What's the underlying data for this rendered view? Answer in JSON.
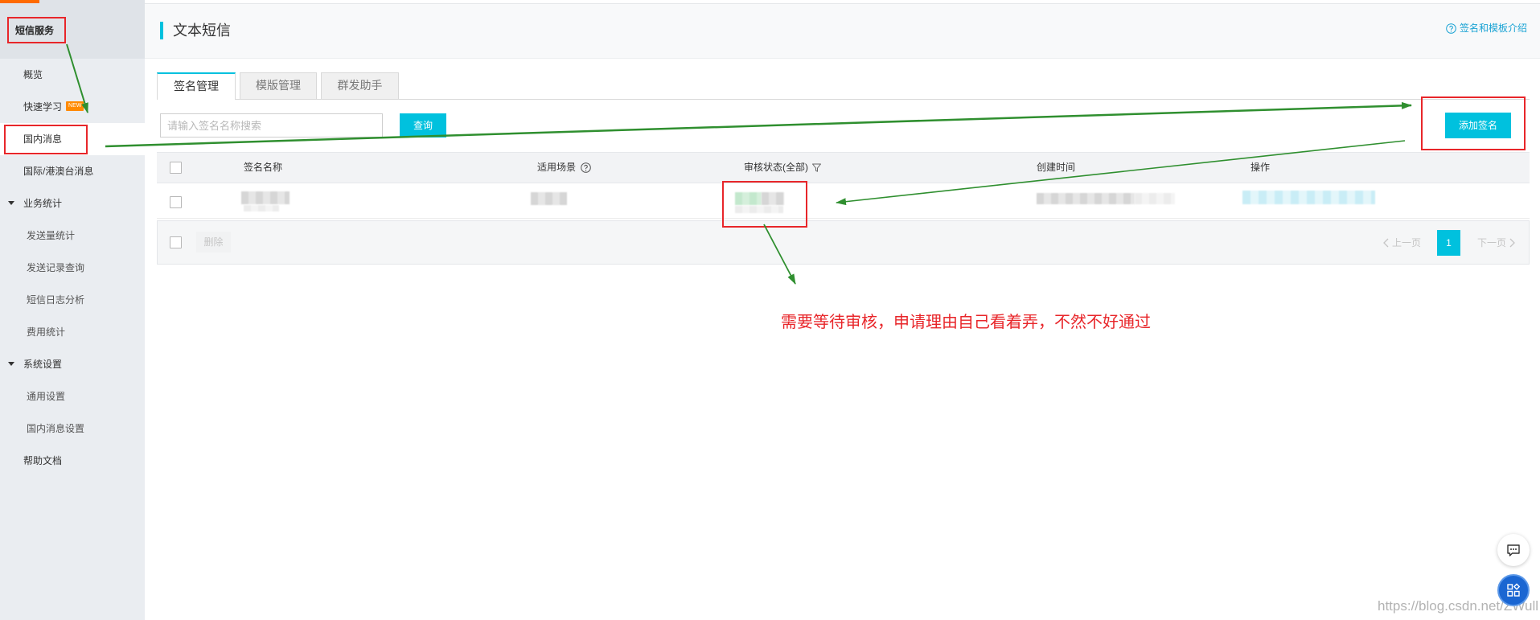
{
  "colors": {
    "accent": "#00c1de",
    "top_bar": "#ff6a00",
    "badge": "#ff8a00",
    "link": "#1aa3d4",
    "annotation_red": "#e8262a",
    "annotation_green": "#2f8f2f",
    "float_button_blue": "#1a66d2"
  },
  "sidebar": {
    "title": "短信服务",
    "items": [
      {
        "label": "概览"
      },
      {
        "label": "快速学习",
        "badge": "NEW"
      },
      {
        "label": "国内消息",
        "selected": true
      },
      {
        "label": "国际/港澳台消息"
      }
    ],
    "groups": [
      {
        "label": "业务统计",
        "expanded": true,
        "icon": "caret-down-icon",
        "children": [
          "发送量统计",
          "发送记录查询",
          "短信日志分析",
          "费用统计"
        ]
      },
      {
        "label": "系统设置",
        "expanded": true,
        "icon": "caret-down-icon",
        "children": [
          "通用设置",
          "国内消息设置"
        ]
      }
    ],
    "help_item": "帮助文档"
  },
  "header": {
    "title": "文本短信",
    "help_link": "签名和模板介绍",
    "help_icon": "question-circle-icon"
  },
  "tabs": [
    {
      "label": "签名管理",
      "active": true
    },
    {
      "label": "模版管理"
    },
    {
      "label": "群发助手"
    }
  ],
  "toolbar": {
    "search_value": "",
    "search_placeholder": "请输入签名名称搜索",
    "search_button": "查询",
    "add_button": "添加签名"
  },
  "table": {
    "columns": [
      {
        "label": "签名名称"
      },
      {
        "label": "适用场景",
        "icon": "help-icon"
      },
      {
        "label": "审核状态(全部)",
        "icon": "filter-icon"
      },
      {
        "label": "创建时间"
      },
      {
        "label": "操作"
      }
    ]
  },
  "table_footer": {
    "delete_button": "删除",
    "prev_page": "上一页",
    "current_page": "1",
    "next_page": "下一页",
    "prev_icon": "chevron-left-icon",
    "next_icon": "chevron-right-icon"
  },
  "annotation": {
    "note": "需要等待审核，申请理由自己看着弄，不然不好通过"
  },
  "floating_buttons": {
    "chat_icon": "chat-bubble-icon",
    "apps_icon": "apps-grid-icon"
  },
  "watermark": "https://blog.csdn.net/ZWull"
}
